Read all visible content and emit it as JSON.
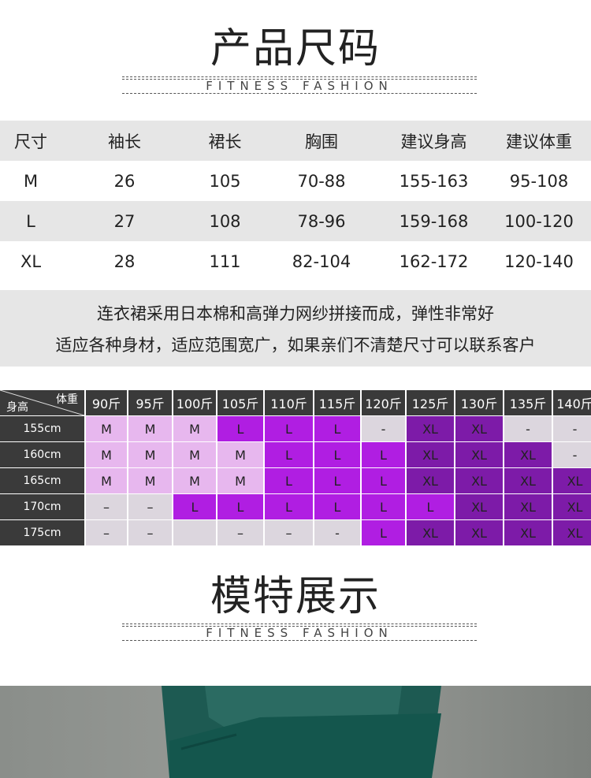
{
  "section1": {
    "title": "产品尺码",
    "subtitle": "FITNESS FASHION"
  },
  "size_table": {
    "headers": [
      "尺寸",
      "袖长",
      "裙长",
      "胸围",
      "建议身高",
      "建议体重"
    ],
    "rows": [
      [
        "M",
        "26",
        "105",
        "70-88",
        "155-163",
        "95-108"
      ],
      [
        "L",
        "27",
        "108",
        "78-96",
        "159-168",
        "100-120"
      ],
      [
        "XL",
        "28",
        "111",
        "82-104",
        "162-172",
        "120-140"
      ]
    ]
  },
  "note": {
    "line1": "连衣裙采用日本棉和高弹力网纱拼接而成，弹性非常好",
    "line2": "适应各种身材，适应范围宽广，如果亲们不清楚尺寸可以联系客户"
  },
  "grid": {
    "corner_weight": "体重",
    "corner_height": "身高",
    "weights": [
      "90斤",
      "95斤",
      "100斤",
      "105斤",
      "110斤",
      "115斤",
      "120斤",
      "125斤",
      "130斤",
      "135斤",
      "140斤"
    ],
    "rows": [
      {
        "height": "155cm",
        "cells": [
          "M",
          "M",
          "M",
          "L",
          "L",
          "L",
          "-",
          "XL",
          "XL",
          "-",
          "-"
        ],
        "levels": [
          1,
          1,
          1,
          2,
          2,
          2,
          0,
          3,
          3,
          0,
          0
        ]
      },
      {
        "height": "160cm",
        "cells": [
          "M",
          "M",
          "M",
          "M",
          "L",
          "L",
          "L",
          "XL",
          "XL",
          "XL",
          "-"
        ],
        "levels": [
          1,
          1,
          1,
          1,
          2,
          2,
          2,
          3,
          3,
          3,
          0
        ]
      },
      {
        "height": "165cm",
        "cells": [
          "M",
          "M",
          "M",
          "M",
          "L",
          "L",
          "L",
          "XL",
          "XL",
          "XL",
          "XL"
        ],
        "levels": [
          1,
          1,
          1,
          1,
          2,
          2,
          2,
          3,
          3,
          3,
          3
        ]
      },
      {
        "height": "170cm",
        "cells": [
          "–",
          "–",
          "L",
          "L",
          "L",
          "L",
          "L",
          "L",
          "XL",
          "XL",
          "XL"
        ],
        "levels": [
          0,
          0,
          2,
          2,
          2,
          2,
          2,
          2,
          3,
          3,
          3
        ]
      },
      {
        "height": "175cm",
        "cells": [
          "–",
          "–",
          "",
          "–",
          "–",
          "-",
          "L",
          "XL",
          "XL",
          "XL",
          "XL"
        ],
        "levels": [
          0,
          0,
          0,
          0,
          0,
          0,
          2,
          3,
          3,
          3,
          3
        ]
      }
    ]
  },
  "section2": {
    "title": "模特展示",
    "subtitle": "FITNESS FASHION"
  }
}
